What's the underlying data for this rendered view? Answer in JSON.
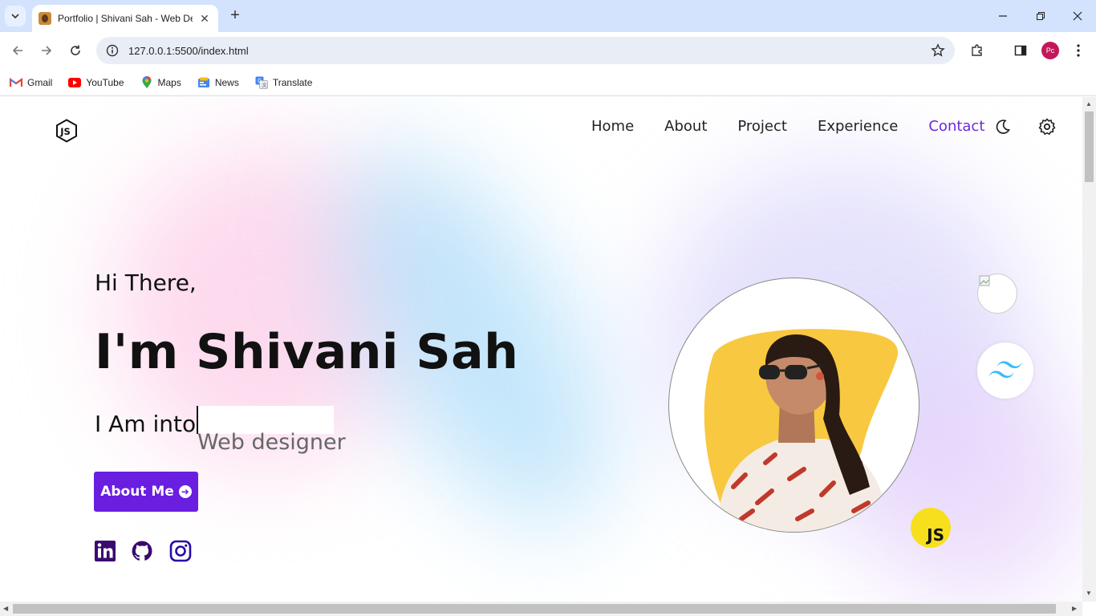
{
  "browser": {
    "tab_title": "Portfolio | Shivani Sah - Web De",
    "url": "127.0.0.1:5500/index.html",
    "profile_initials": "Pc",
    "bookmarks": [
      {
        "label": "Gmail",
        "icon": "gmail-icon"
      },
      {
        "label": "YouTube",
        "icon": "youtube-icon"
      },
      {
        "label": "Maps",
        "icon": "maps-icon"
      },
      {
        "label": "News",
        "icon": "news-icon"
      },
      {
        "label": "Translate",
        "icon": "translate-icon"
      }
    ]
  },
  "page": {
    "nav": [
      {
        "label": "Home",
        "active": false
      },
      {
        "label": "About",
        "active": false
      },
      {
        "label": "Project",
        "active": false
      },
      {
        "label": "Experience",
        "active": false
      },
      {
        "label": "Contact",
        "active": true
      }
    ],
    "hero": {
      "greeting": "Hi There,",
      "name": "I'm Shivani Sah",
      "into_label": "I Am into",
      "typed_role": "Web designer",
      "button_label": "About Me"
    },
    "js_badge": "JS",
    "social": [
      "linkedin-icon",
      "github-icon",
      "instagram-icon"
    ],
    "accent_color": "#6a1ee0"
  }
}
